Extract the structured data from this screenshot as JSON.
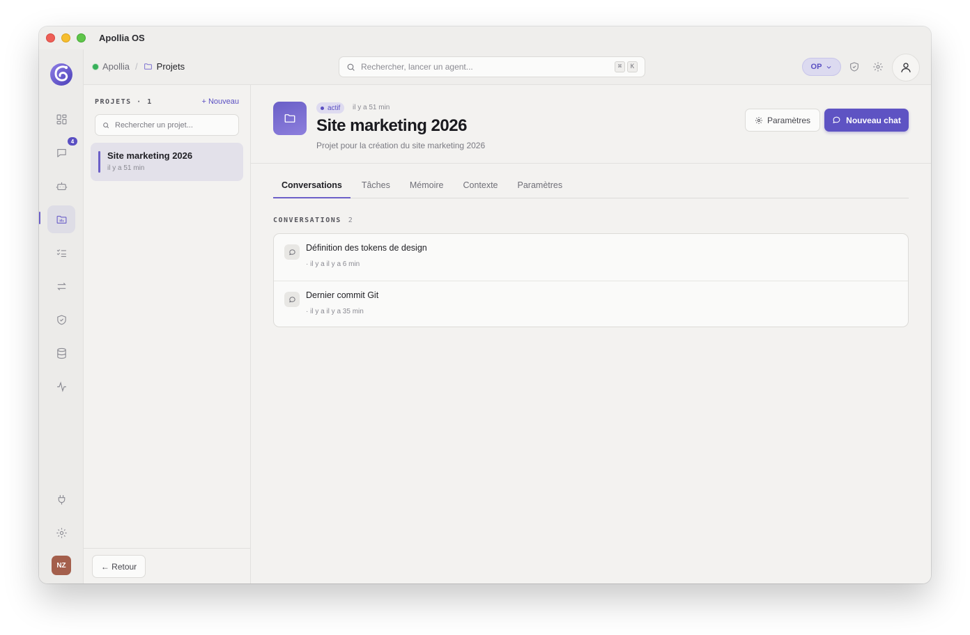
{
  "window": {
    "title": "Apollia OS"
  },
  "rail": {
    "items": [
      {
        "name": "dashboard-icon"
      },
      {
        "name": "chat-icon",
        "badge": "4"
      },
      {
        "name": "robot-icon"
      },
      {
        "name": "projects-icon",
        "active": true
      },
      {
        "name": "tasks-icon"
      },
      {
        "name": "swap-icon"
      },
      {
        "name": "shield-icon"
      },
      {
        "name": "database-icon"
      },
      {
        "name": "activity-icon"
      },
      {
        "name": "plug-icon"
      },
      {
        "name": "gear-icon"
      }
    ],
    "avatar": "NZ"
  },
  "topbar": {
    "breadcrumb_root": "Apollia",
    "breadcrumb_sep": "/",
    "breadcrumb_current": "Projets",
    "search_placeholder": "Rechercher, lancer un agent...",
    "shortcut_key1": "⌘",
    "shortcut_key2": "K",
    "op_label": "OP"
  },
  "projects": {
    "title": "PROJETS · 1",
    "new_label": "+ Nouveau",
    "search_placeholder": "Rechercher un projet...",
    "items": [
      {
        "name": "Site marketing 2026",
        "time": "il y a 51 min"
      }
    ],
    "back_label": "← Retour"
  },
  "project": {
    "status": "actif",
    "time": "il y a 51 min",
    "title": "Site marketing 2026",
    "subtitle": "Projet pour la création du site marketing 2026",
    "params_label": "Paramètres",
    "newchat_label": "Nouveau chat"
  },
  "tabs": [
    {
      "label": "Conversations",
      "active": true
    },
    {
      "label": "Tâches"
    },
    {
      "label": "Mémoire"
    },
    {
      "label": "Contexte"
    },
    {
      "label": "Paramètres"
    }
  ],
  "conversations": {
    "title": "CONVERSATIONS",
    "count": "2",
    "items": [
      {
        "title": "Définition des tokens de design",
        "time": "· il y a il y a 6 min"
      },
      {
        "title": "Dernier commit Git",
        "time": "· il y a il y a 35 min"
      }
    ]
  },
  "colors": {
    "accent": "#5e53c3",
    "accent_light": "#dedbf0",
    "status_green": "#38b05a",
    "background": "#f3f2f0"
  }
}
